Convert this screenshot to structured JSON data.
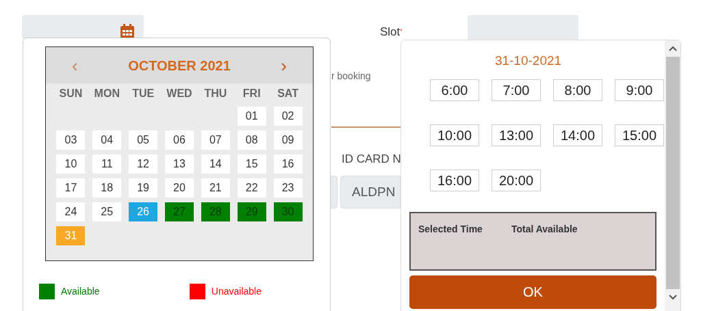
{
  "form": {
    "slot_label": "Slot",
    "required_mark": "*",
    "booking_text": "r booking",
    "id_card_label": "ID CARD N",
    "id_card_value": "ALDPN"
  },
  "calendar": {
    "prev": "‹",
    "month": "OCTOBER 2021",
    "next": "›",
    "weekdays": [
      "SUN",
      "MON",
      "TUE",
      "WED",
      "THU",
      "FRI",
      "SAT"
    ],
    "weeks": [
      {
        "days": [
          {
            "label": "01",
            "kind": "open"
          },
          {
            "label": "02",
            "kind": "open"
          }
        ]
      },
      {
        "days": [
          {
            "label": "03",
            "kind": "open"
          },
          {
            "label": "04",
            "kind": "open"
          },
          {
            "label": "05",
            "kind": "open"
          },
          {
            "label": "06",
            "kind": "open"
          },
          {
            "label": "07",
            "kind": "open"
          },
          {
            "label": "08",
            "kind": "open"
          },
          {
            "label": "09",
            "kind": "open"
          }
        ]
      },
      {
        "days": [
          {
            "label": "10",
            "kind": "open"
          },
          {
            "label": "11",
            "kind": "open"
          },
          {
            "label": "12",
            "kind": "open"
          },
          {
            "label": "13",
            "kind": "open"
          },
          {
            "label": "14",
            "kind": "open"
          },
          {
            "label": "15",
            "kind": "open"
          },
          {
            "label": "16",
            "kind": "open"
          }
        ]
      },
      {
        "days": [
          {
            "label": "17",
            "kind": "open"
          },
          {
            "label": "18",
            "kind": "open"
          },
          {
            "label": "19",
            "kind": "open"
          },
          {
            "label": "20",
            "kind": "open"
          },
          {
            "label": "21",
            "kind": "open"
          },
          {
            "label": "22",
            "kind": "open"
          },
          {
            "label": "23",
            "kind": "open"
          }
        ]
      },
      {
        "days": [
          {
            "label": "24",
            "kind": "open"
          },
          {
            "label": "25",
            "kind": "open"
          },
          {
            "label": "26",
            "kind": "today"
          },
          {
            "label": "27",
            "kind": "available"
          },
          {
            "label": "28",
            "kind": "available"
          },
          {
            "label": "29",
            "kind": "available"
          },
          {
            "label": "30",
            "kind": "available"
          }
        ]
      },
      {
        "days": [
          {
            "label": "31",
            "kind": "selected"
          }
        ]
      }
    ],
    "legend": [
      {
        "label": "Available",
        "color": "#008000"
      },
      {
        "label": "Unavailable",
        "color": "#ff0000"
      }
    ]
  },
  "slots": {
    "date": "31-10-2021",
    "times": [
      "6:00",
      "7:00",
      "8:00",
      "9:00",
      "10:00",
      "13:00",
      "14:00",
      "15:00",
      "16:00",
      "20:00"
    ],
    "summary_columns": [
      "Selected Time",
      "Total Available"
    ],
    "ok": "OK"
  }
}
